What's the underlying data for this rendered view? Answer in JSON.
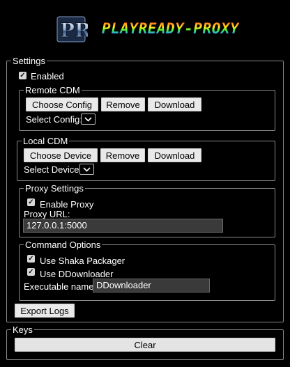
{
  "header": {
    "app_name": "PLAYREADY-PROXY",
    "logo_icon": "pr-logo-icon"
  },
  "settings": {
    "legend": "Settings",
    "enabled_label": "Enabled",
    "enabled_checked": true,
    "remote_cdm": {
      "legend": "Remote CDM",
      "choose_label": "Choose Config",
      "remove_label": "Remove",
      "download_label": "Download",
      "select_label": "Select Config:"
    },
    "local_cdm": {
      "legend": "Local CDM",
      "choose_label": "Choose Device",
      "remove_label": "Remove",
      "download_label": "Download",
      "select_label": "Select Device:"
    },
    "proxy": {
      "legend": "Proxy Settings",
      "enable_label": "Enable Proxy",
      "enable_checked": true,
      "url_label": "Proxy URL:",
      "url_value": "127.0.0.1:5000"
    },
    "command": {
      "legend": "Command Options",
      "shaka_label": "Use Shaka Packager",
      "shaka_checked": true,
      "ddl_label": "Use DDownloader",
      "ddl_checked": true,
      "exe_label": "Executable name:",
      "exe_value": "DDownloader"
    },
    "export_label": "Export Logs"
  },
  "keys": {
    "legend": "Keys",
    "clear_label": "Clear"
  },
  "colors": {
    "background": "#000000",
    "button": "#e9e9e9",
    "border": "#8a8a8a"
  }
}
